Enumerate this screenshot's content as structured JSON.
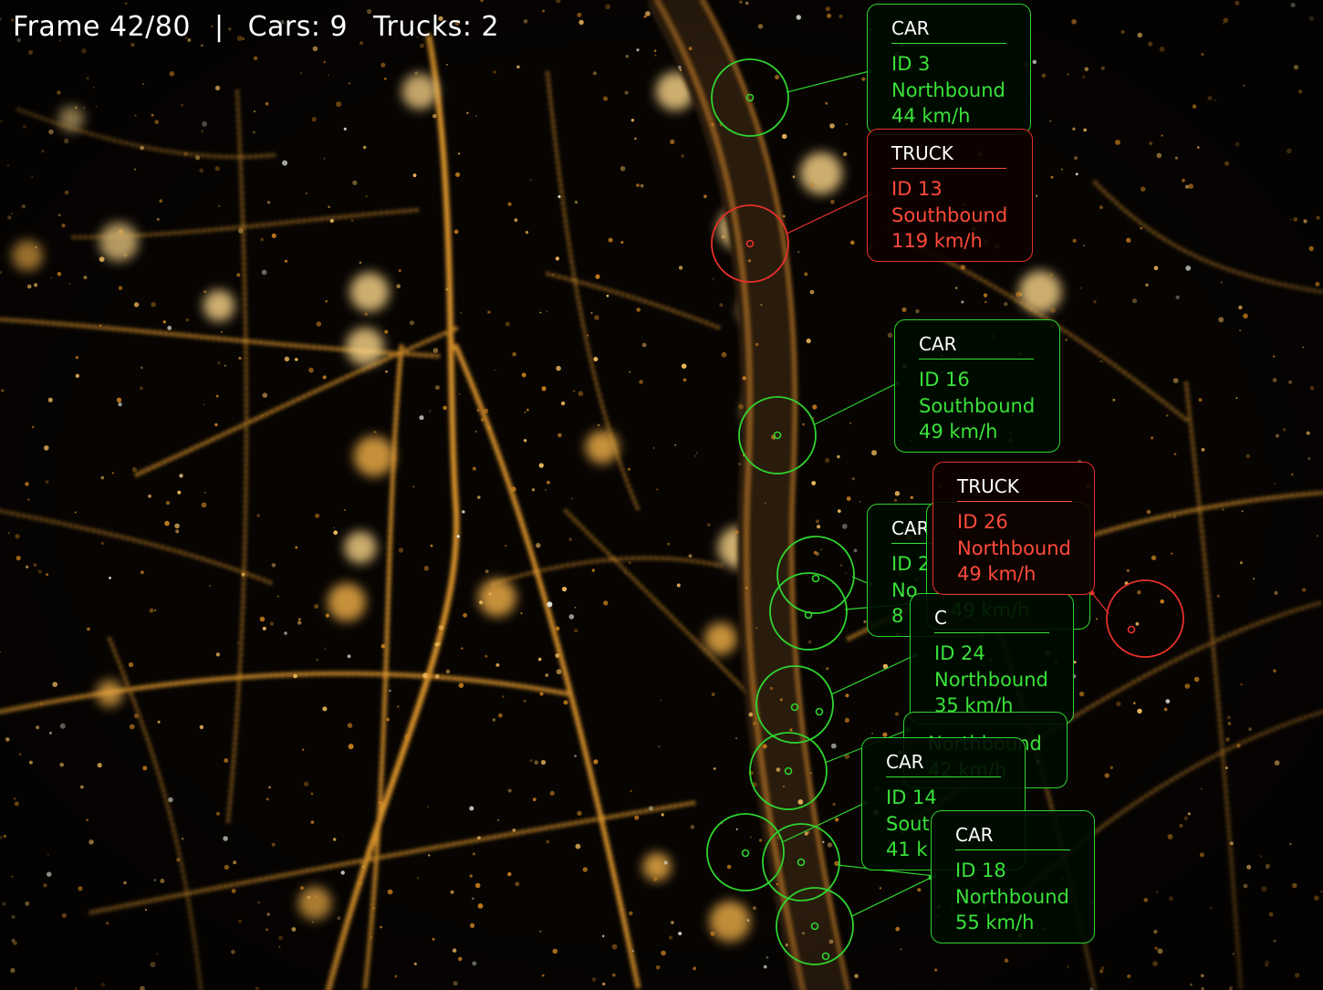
{
  "hud": {
    "frame": "Frame 42/80",
    "separator": "|",
    "cars": "Cars: 9",
    "trucks": "Trucks: 2"
  },
  "colors": {
    "car": "#2fd42f",
    "truck": "#e8302a",
    "hud_text": "#ffffff",
    "city_light": "#f2a93a"
  },
  "detections": [
    {
      "type": "CAR",
      "id": "ID 3",
      "direction": "Northbound",
      "speed": "44 km/h"
    },
    {
      "type": "TRUCK",
      "id": "ID 13",
      "direction": "Southbound",
      "speed": "119 km/h"
    },
    {
      "type": "CAR",
      "id": "ID 16",
      "direction": "Southbound",
      "speed": "49 km/h"
    },
    {
      "type": "CAR",
      "id": "ID 2",
      "direction": "No",
      "speed": "8"
    },
    {
      "type": "",
      "id": "",
      "direction": "",
      "speed": "49 km/h"
    },
    {
      "type": "TRUCK",
      "id": "ID 26",
      "direction": "Northbound",
      "speed": "49 km/h"
    },
    {
      "type": "C",
      "id": "ID 24",
      "direction": "Northbound",
      "speed": "35 km/h"
    },
    {
      "type": "",
      "id": "",
      "direction": "Northbound",
      "speed": "42 km/h"
    },
    {
      "type": "CAR",
      "id": "ID 14",
      "direction": "Sout",
      "speed": "41 k"
    },
    {
      "type": "CAR",
      "id": "ID 18",
      "direction": "Northbound",
      "speed": "55 km/h"
    }
  ]
}
